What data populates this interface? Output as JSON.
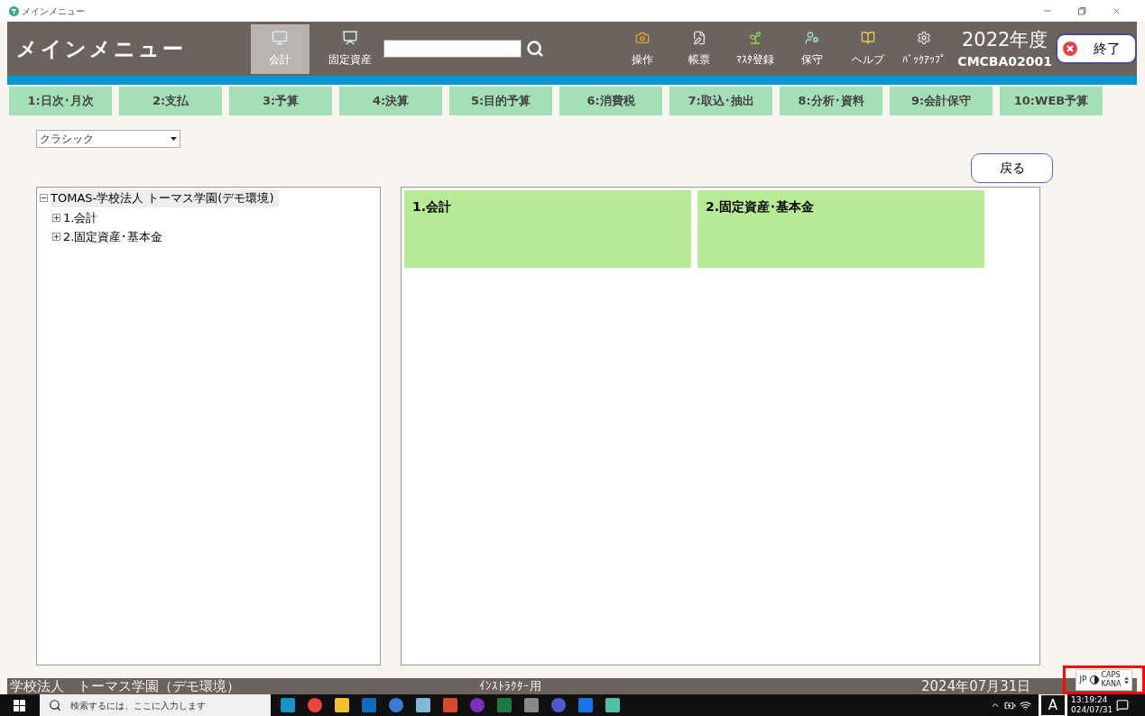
{
  "titlebar": {
    "title": "メインメニュー"
  },
  "header": {
    "title": "メインメニュー",
    "modules": [
      {
        "label": "会計",
        "selected": true
      },
      {
        "label": "固定資産",
        "selected": false
      }
    ],
    "tools": [
      "操作",
      "帳票",
      "ﾏｽﾀ登録",
      "保守",
      "ヘルプ",
      "ﾊﾞｯｸｱｯﾌﾟ"
    ],
    "fiscal_year": "2022年度",
    "code": "CMCBA02001",
    "exit_button": "終了"
  },
  "tabs": [
    "1:日次･月次",
    "2:支払",
    "3:予算",
    "4:決算",
    "5:目的予算",
    "6:消費税",
    "7:取込･抽出",
    "8:分析･資料",
    "9:会計保守",
    "10:WEB予算"
  ],
  "view_select": {
    "value": "クラシック"
  },
  "back_button": "戻る",
  "tree": {
    "label": "TOMAS-学校法人 トーマス学園(デモ環境)",
    "expanded": true,
    "selected": true,
    "children": [
      {
        "label": "1.会計",
        "expanded": false,
        "selected": false
      },
      {
        "label": "2.固定資産･基本金",
        "expanded": false,
        "selected": false
      }
    ]
  },
  "tiles": [
    "1.会計",
    "2.固定資産･基本金"
  ],
  "status_bar": {
    "organization": "学校法人　トーマス学園（デモ環境）",
    "user_type": "ｲﾝｽﾄﾗｸﾀｰ用",
    "date": "2024年07月31日"
  },
  "ime_panel": {
    "indicators": [
      "JP",
      "CAPS",
      "KANA"
    ]
  },
  "taskbar": {
    "search_placeholder": "検索するには、ここに入力します",
    "input_mode": "A",
    "time": "13:19:24",
    "date": "024/07/31"
  }
}
